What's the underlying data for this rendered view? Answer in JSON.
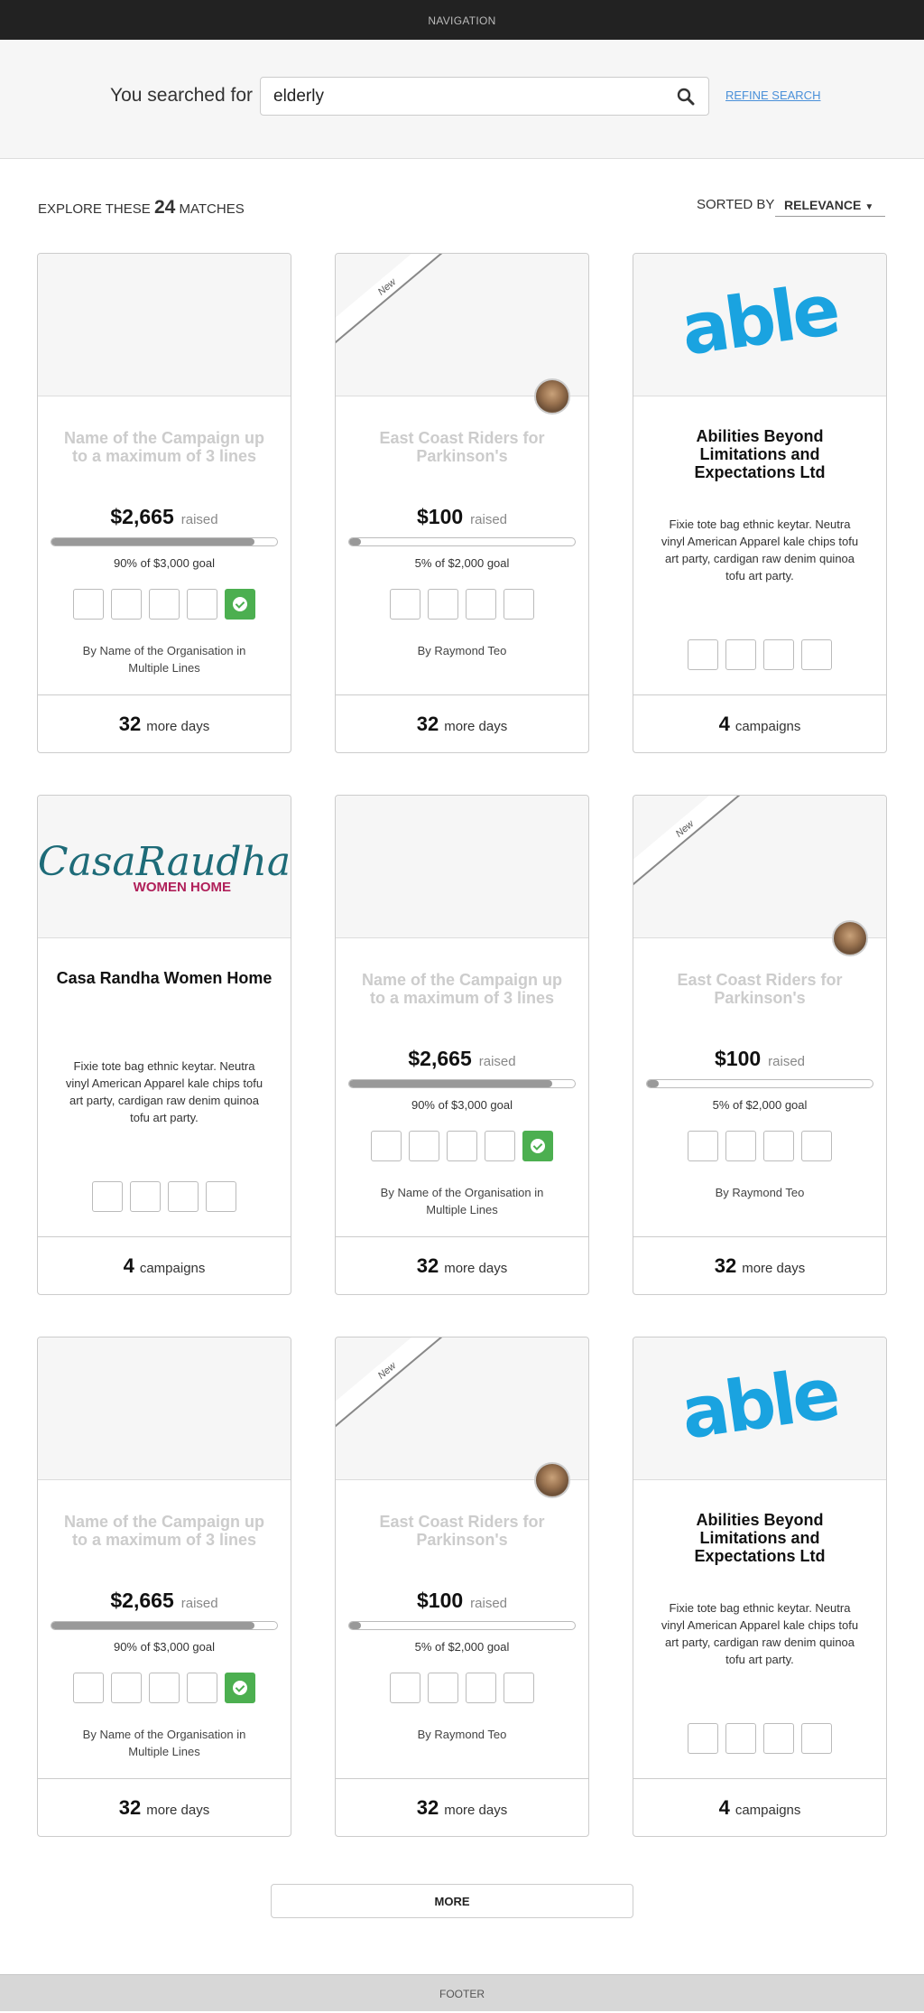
{
  "nav": {
    "label": "NAVIGATION"
  },
  "search": {
    "prefix": "You searched for",
    "value": "elderly",
    "refine": "REFINE SEARCH"
  },
  "results": {
    "explore_pre": "EXPLORE THESE",
    "count": "24",
    "explore_post": "MATCHES",
    "sorted_by": "SORTED BY",
    "sort_value": "RELEVANCE"
  },
  "cards": [
    {
      "type": "campaign",
      "title": "Name of the Campaign up to a maximum of 3 lines",
      "raised": "$2,665",
      "raised_suffix": "raised",
      "progress": 0.9,
      "goal": "90% of $3,000 goal",
      "verified": true,
      "by": "By Name of the Organisation in Multiple Lines",
      "days": "32",
      "days_suffix": "more days",
      "is_new": false
    },
    {
      "type": "campaign",
      "title": "East Coast Riders for Parkinson's",
      "raised": "$100",
      "raised_suffix": "raised",
      "progress": 0.05,
      "goal": "5% of $2,000 goal",
      "verified": false,
      "by": "By Raymond Teo",
      "days": "32",
      "days_suffix": "more days",
      "is_new": true,
      "ribbon": "New"
    },
    {
      "type": "org",
      "logo": "able",
      "title": "Abilities Beyond Limitations and Expectations Ltd",
      "desc": "Fixie tote bag ethnic keytar. Neutra vinyl American Apparel kale chips tofu art party, cardigan raw denim quinoa tofu art party.",
      "campaigns": "4",
      "campaigns_suffix": "campaigns"
    },
    {
      "type": "org",
      "logo": "casa",
      "logo_text": "CasaRaudha",
      "logo_sub": "WOMEN HOME",
      "title": "Casa Randha Women Home",
      "desc": "Fixie tote bag ethnic keytar. Neutra vinyl American Apparel kale chips tofu art party, cardigan raw denim quinoa tofu art party.",
      "campaigns": "4",
      "campaigns_suffix": "campaigns"
    },
    {
      "type": "campaign",
      "title": "Name of the Campaign up to a maximum of 3 lines",
      "raised": "$2,665",
      "raised_suffix": "raised",
      "progress": 0.9,
      "goal": "90% of $3,000 goal",
      "verified": true,
      "by": "By Name of the Organisation in Multiple Lines",
      "days": "32",
      "days_suffix": "more days",
      "is_new": false
    },
    {
      "type": "campaign",
      "title": "East Coast Riders for Parkinson's",
      "raised": "$100",
      "raised_suffix": "raised",
      "progress": 0.05,
      "goal": "5% of $2,000 goal",
      "verified": false,
      "by": "By Raymond Teo",
      "days": "32",
      "days_suffix": "more days",
      "is_new": true,
      "ribbon": "New"
    },
    {
      "type": "campaign",
      "title": "Name of the Campaign up to a maximum of 3 lines",
      "raised": "$2,665",
      "raised_suffix": "raised",
      "progress": 0.9,
      "goal": "90% of $3,000 goal",
      "verified": true,
      "by": "By Name of the Organisation in Multiple Lines",
      "days": "32",
      "days_suffix": "more days",
      "is_new": false
    },
    {
      "type": "campaign",
      "title": "East Coast Riders for Parkinson's",
      "raised": "$100",
      "raised_suffix": "raised",
      "progress": 0.05,
      "goal": "5% of $2,000 goal",
      "verified": false,
      "by": "By Raymond Teo",
      "days": "32",
      "days_suffix": "more days",
      "is_new": true,
      "ribbon": "New"
    },
    {
      "type": "org",
      "logo": "able",
      "title": "Abilities Beyond Limitations and Expectations Ltd",
      "desc": "Fixie tote bag ethnic keytar. Neutra vinyl American Apparel kale chips tofu art party, cardigan raw denim quinoa tofu art party.",
      "campaigns": "4",
      "campaigns_suffix": "campaigns"
    }
  ],
  "more": {
    "label": "MORE"
  },
  "footer": {
    "label": "FOOTER"
  },
  "colors": {
    "accent_link": "#4a90d9",
    "verified_green": "#4caf50",
    "able_blue": "#1aa3e0",
    "casa_teal": "#1d6b78",
    "casa_magenta": "#b0205a"
  }
}
